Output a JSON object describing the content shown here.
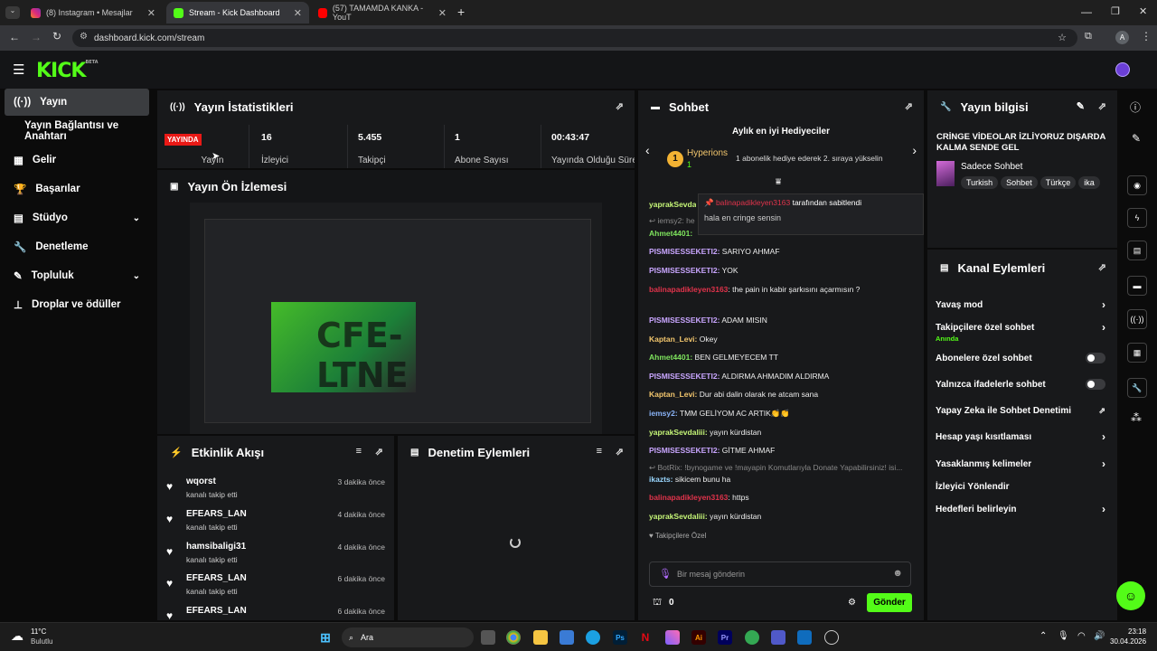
{
  "browser": {
    "tabs": [
      {
        "label": "(8) Instagram • Mesajlar"
      },
      {
        "label": "Stream - Kick Dashboard"
      },
      {
        "label": "(57) TAMAMDA KANKA - YouT"
      }
    ],
    "url": "dashboard.kick.com/stream",
    "profile": "A"
  },
  "app": {
    "logo": "KICK",
    "logo_sup": "BETA"
  },
  "sidebar": {
    "items": [
      {
        "label": "Yayın"
      },
      {
        "label": "Yayın Bağlantısı ve Anahtarı"
      },
      {
        "label": "Gelir"
      },
      {
        "label": "Başarılar"
      },
      {
        "label": "Stüdyo"
      },
      {
        "label": "Denetleme"
      },
      {
        "label": "Topluluk"
      },
      {
        "label": "Droplar ve ödüller"
      }
    ]
  },
  "stats": {
    "title": "Yayın İstatistikleri",
    "live_badge": "YAYINDA",
    "items": [
      {
        "value": "",
        "label": "Yayın"
      },
      {
        "value": "16",
        "label": "İzleyici"
      },
      {
        "value": "5.455",
        "label": "Takipçi"
      },
      {
        "value": "1",
        "label": "Abone Sayısı"
      },
      {
        "value": "00:43:47",
        "label": "Yayında Olduğu Süre"
      }
    ]
  },
  "preview": {
    "title": "Yayın Ön İzlemesi"
  },
  "activity": {
    "title": "Etkinlik Akışı",
    "events": [
      {
        "name": "wqorst",
        "sub": "kanalı takip etti",
        "time": "3 dakika önce"
      },
      {
        "name": "EFEARS_LAN",
        "sub": "kanalı takip etti",
        "time": "4 dakika önce"
      },
      {
        "name": "hamsibaligi31",
        "sub": "kanalı takip etti",
        "time": "4 dakika önce"
      },
      {
        "name": "EFEARS_LAN",
        "sub": "kanalı takip etti",
        "time": "6 dakika önce"
      },
      {
        "name": "EFEARS_LAN",
        "sub": "",
        "time": "6 dakika önce"
      }
    ]
  },
  "moderation": {
    "title": "Denetim Eylemleri"
  },
  "chat": {
    "title": "Sohbet",
    "gifters_title": "Aylık en iyi Hediyeciler",
    "gifter_name": "Hyperions",
    "gifter_count": "1",
    "gifter_note": "1 abonelik hediye ederek 2. sıraya yükselin",
    "pinned_by": "tarafından sabitlendi",
    "pinned_user": "balinapadikleyen3163",
    "pinned_text": "hala en cringe sensin",
    "messages": [
      {
        "user": "yaprakSevdaliii:",
        "text": "",
        "color": "#c5f577"
      },
      {
        "user": "",
        "text": "↩ iemsy2: he",
        "color": "#888"
      },
      {
        "user": "Ahmet4401:",
        "text": "",
        "color": "#7ee35d"
      },
      {
        "user": "PISMISESSEKETI2:",
        "text": " SARIYO AHMAF",
        "color": "#c9a6ff"
      },
      {
        "user": "PISMISESSEKETI2:",
        "text": " YOK",
        "color": "#c9a6ff"
      },
      {
        "user": "balinapadikleyen3163",
        "text": ": the pain in kabir şarkısını açarmısın ?",
        "color": "#e0334b"
      },
      {
        "user": "PISMISESSEKETI2:",
        "text": " ADAM MISIN",
        "color": "#c9a6ff"
      },
      {
        "user": "Kaptan_Levi:",
        "text": " Okey",
        "color": "#f2c66d"
      },
      {
        "user": "Ahmet4401:",
        "text": " BEN GELMEYECEM TT",
        "color": "#7ee35d"
      },
      {
        "user": "PISMISESSEKETI2:",
        "text": " ALDIRMA AHMADIM ALDIRMA",
        "color": "#c9a6ff"
      },
      {
        "user": "Kaptan_Levi:",
        "text": " Dur abi dalin olarak ne atcam sana",
        "color": "#f2c66d"
      },
      {
        "user": "iemsy2:",
        "text": " TMM GELİYOM AC ARTIK👏👏",
        "color": "#8ab4f8"
      },
      {
        "user": "yaprakSevdaliii:",
        "text": " yayın kürdistan",
        "color": "#c5f577"
      },
      {
        "user": "PISMISESSEKETI2:",
        "text": " GİTME AHMAF",
        "color": "#c9a6ff"
      },
      {
        "user": "",
        "text": "↩ BotRix: !bynogame ve !mayapin Komutlarıyla Donate Yapabilirsiniz! isi...",
        "color": "#888"
      },
      {
        "user": "ikazts:",
        "text": " sikicem bunu ha",
        "color": "#9ad7ff"
      },
      {
        "user": "balinapadikleyen3163",
        "text": ": https",
        "color": "#e0334b"
      },
      {
        "user": "yaprakSevdaliii:",
        "text": " yayın kürdistan",
        "color": "#c5f577"
      }
    ],
    "followers_only": "Takipçilere Özel",
    "input_placeholder": "Bir mesaj gönderin",
    "points": "0",
    "send": "Gönder"
  },
  "stream_info": {
    "title": "Yayın bilgisi",
    "stream_title": "CRİNGE VİDEOLAR İZLİYORUZ DIŞARDA KALMA SENDE GEL",
    "category": "Sadece Sohbet",
    "tags": [
      "Turkish",
      "Sohbet",
      "Türkçe",
      "ika"
    ]
  },
  "channel_actions": {
    "title": "Kanal Eylemleri",
    "items": [
      {
        "label": "Yavaş mod",
        "sub": "",
        "type": "arrow"
      },
      {
        "label": "Takipçilere özel sohbet",
        "sub": "Anında",
        "type": "arrow"
      },
      {
        "label": "Abonelere özel sohbet",
        "sub": "",
        "type": "toggle"
      },
      {
        "label": "Yalnızca ifadelerle sohbet",
        "sub": "",
        "type": "toggle"
      },
      {
        "label": "Yapay Zeka ile Sohbet Denetimi",
        "sub": "",
        "type": "ext"
      },
      {
        "label": "Hesap yaşı kısıtlaması",
        "sub": "",
        "type": "arrow"
      },
      {
        "label": "Yasaklanmış kelimeler",
        "sub": "",
        "type": "arrow"
      },
      {
        "label": "İzleyici Yönlendir",
        "sub": "",
        "type": "none"
      },
      {
        "label": "Hedefleri belirleyin",
        "sub": "",
        "type": "arrow"
      }
    ]
  },
  "taskbar": {
    "weather_temp": "11°C",
    "weather_desc": "Bulutlu",
    "search": "Ara",
    "time": "23:18",
    "date": "30.04.2026"
  }
}
